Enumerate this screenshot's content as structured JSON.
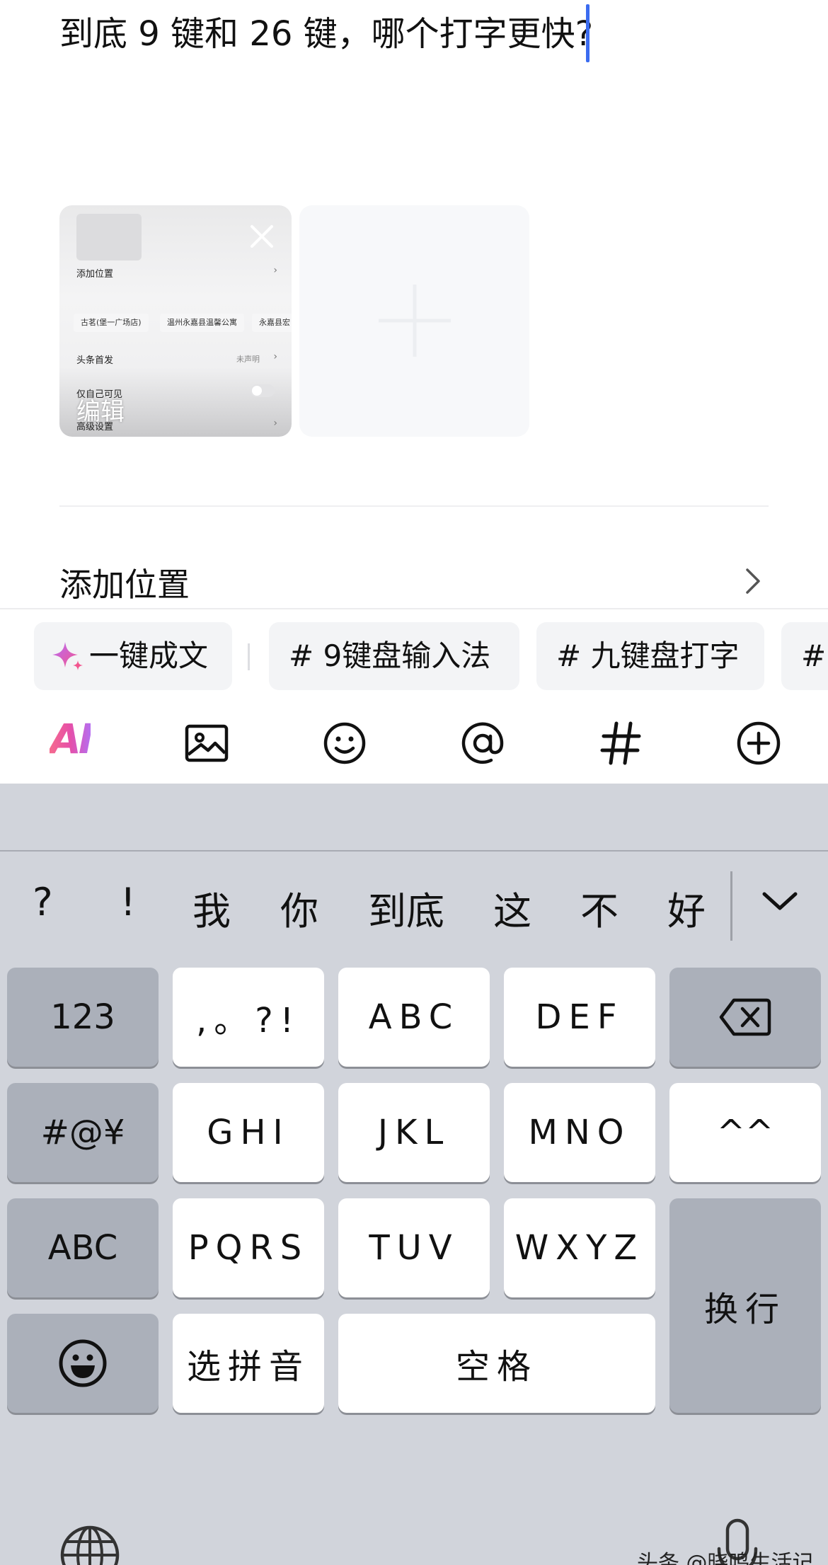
{
  "post": {
    "title": "到底 9 键和 26 键，哪个打字更快?",
    "image_thumbnail": {
      "rows": {
        "add_location": "添加位置",
        "first_publish": "头条首发",
        "first_publish_value": "未声明",
        "only_me": "仅自己可见",
        "advanced": "高级设置"
      },
      "chips": [
        "古茗(堡一广场店)",
        "温州永嘉县温馨公寓",
        "永嘉县宏"
      ],
      "edit_label": "编辑"
    }
  },
  "location": {
    "label": "添加位置"
  },
  "chips": [
    {
      "label": "一键成文"
    },
    {
      "label": "# 9键盘输入法"
    },
    {
      "label": "# 九键盘打字"
    },
    {
      "label": "#"
    }
  ],
  "toolbar": {
    "ai_label": "AI",
    "icons": [
      "image-icon",
      "emoji-icon",
      "at-icon",
      "hashtag-icon",
      "add-circle-icon"
    ]
  },
  "keyboard": {
    "candidates": [
      "?",
      "!",
      "我",
      "你",
      "到底",
      "这",
      "不",
      "好"
    ],
    "rows": [
      [
        "123",
        ",。?!",
        "ABC",
        "DEF",
        "delete"
      ],
      [
        "#@¥",
        "GHI",
        "JKL",
        "MNO",
        "^^"
      ],
      [
        "ABC",
        "PQRS",
        "TUV",
        "WXYZ",
        "换行"
      ],
      [
        "emoji",
        "选拼音",
        "空格"
      ]
    ],
    "keys": {
      "num": "123",
      "punct": ",。?!",
      "abc": "ABC",
      "def": "DEF",
      "symbols": "#@¥",
      "ghi": "GHI",
      "jkl": "JKL",
      "mno": "MNO",
      "kaomoji": "^^",
      "abc_switch": "ABC",
      "pqrs": "PQRS",
      "tuv": "TUV",
      "wxyz": "WXYZ",
      "enter": "换行",
      "pinyin": "选拼音",
      "space": "空格"
    }
  },
  "watermark": "头条 @晓鸣生活记",
  "colors": {
    "caret": "#3b6cf0",
    "keyboard_bg": "#d1d4db",
    "key_dark": "#abb0ba",
    "chip_bg": "#f3f4f6"
  }
}
